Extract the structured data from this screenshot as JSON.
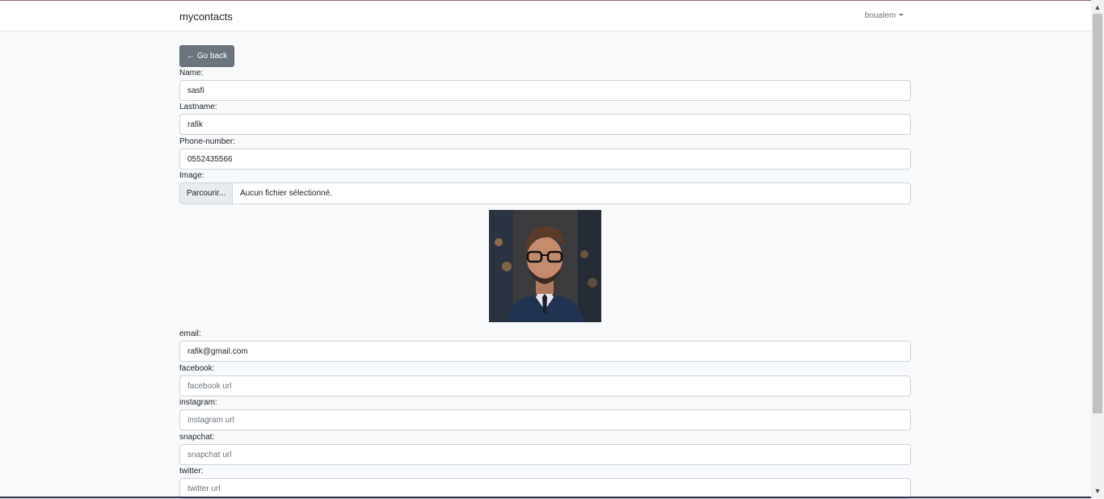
{
  "navbar": {
    "brand": "mycontacts",
    "user": "boualem"
  },
  "back_button": {
    "label": "Go back",
    "icon": "arrow-left-icon"
  },
  "form": {
    "name": {
      "label": "Name:",
      "value": "sasfi"
    },
    "lastname": {
      "label": "Lastname:",
      "value": "rafik"
    },
    "phone": {
      "label": "Phone-number:",
      "value": "0552435566"
    },
    "image": {
      "label": "Image:",
      "browse_label": "Parcourir...",
      "file_status": "Aucun fichier sélectionné."
    },
    "email": {
      "label": "email:",
      "value": "rafik@gmail.com"
    },
    "facebook": {
      "label": "facebook:",
      "value": "",
      "placeholder": "facebook url"
    },
    "instagram": {
      "label": "instagram:",
      "value": "",
      "placeholder": "instagram url"
    },
    "snapchat": {
      "label": "snapchat:",
      "value": "",
      "placeholder": "snapchat url"
    },
    "twitter": {
      "label": "twitter:",
      "value": "",
      "placeholder": "twitter url"
    }
  },
  "colors": {
    "page_bg": "#f8f9fa",
    "secondary_button": "#6c757d",
    "input_border": "#ced4da"
  }
}
